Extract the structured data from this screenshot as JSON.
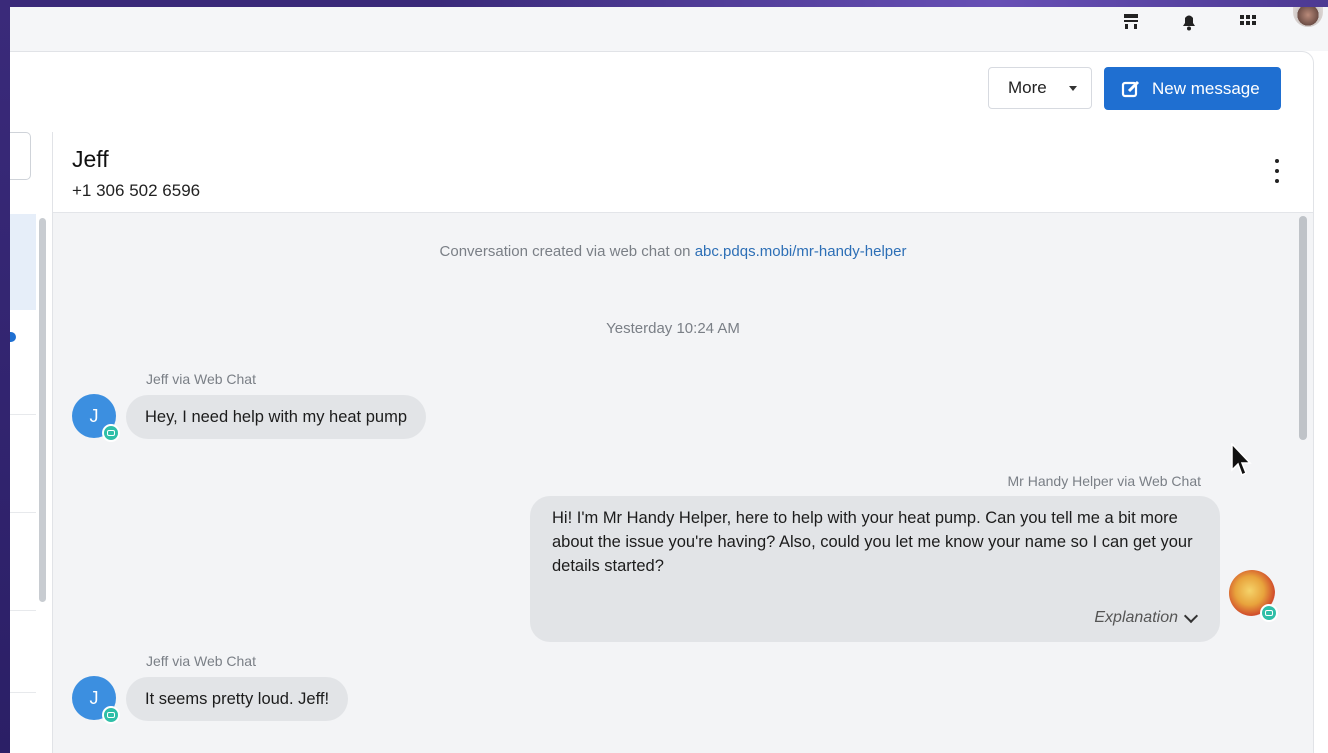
{
  "window": {
    "topbar_icons": [
      "announcement-icon",
      "bell-icon",
      "apps-grid-icon",
      "user-avatar"
    ]
  },
  "toolbar": {
    "more_label": "More",
    "new_message_label": "New message"
  },
  "contact": {
    "name": "Jeff",
    "phone": "+1 306 502 6596"
  },
  "conversation": {
    "created_text": "Conversation created via web chat on ",
    "created_link": "abc.pdqs.mobi/mr-handy-helper",
    "date_separator": "Yesterday 10:24 AM",
    "messages": [
      {
        "sender": "Jeff via Web Chat",
        "avatar_initial": "J",
        "text": "Hey, I need help with my heat pump",
        "direction": "incoming"
      },
      {
        "sender": "Mr Handy Helper via Web Chat",
        "text": "Hi! I'm Mr Handy Helper, here to help with your heat pump. Can you tell me a bit more about the issue you're having? Also, could you let me know your name so I can get your details started?",
        "explanation_label": "Explanation",
        "direction": "outgoing"
      },
      {
        "sender": "Jeff via Web Chat",
        "avatar_initial": "J",
        "text": "It seems pretty loud. Jeff!",
        "direction": "incoming"
      }
    ]
  },
  "colors": {
    "primary": "#1f6fd1",
    "avatar": "#3c8fe0",
    "channel_badge": "#2fbfa8",
    "bubble": "#e2e4e7",
    "link": "#2d6fb6"
  }
}
